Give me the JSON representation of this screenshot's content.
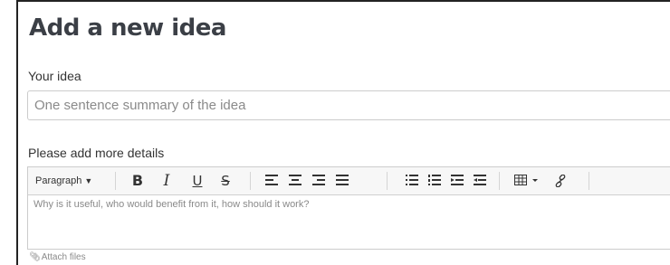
{
  "page": {
    "title": "Add a new idea"
  },
  "idea": {
    "label": "Your idea",
    "value": "",
    "placeholder": "One sentence summary of the idea"
  },
  "details": {
    "label": "Please add more details",
    "placeholder": "Why is it useful, who would benefit from it, how should it work?"
  },
  "toolbar": {
    "format_label": "Paragraph",
    "caret": "▼",
    "bold": "B",
    "italic": "I",
    "underline": "U",
    "strikethrough": "S",
    "icons": [
      "align-left-icon",
      "align-center-icon",
      "align-right-icon",
      "align-justify-icon",
      "bullet-list-icon",
      "numbered-list-icon",
      "outdent-icon",
      "indent-icon",
      "table-icon",
      "link-icon"
    ]
  },
  "attach": {
    "icon": "paperclip-icon",
    "label": "Attach files"
  },
  "colors": {
    "title": "#3b3f46",
    "border": "#cccccc",
    "placeholder": "#8a8a8a"
  }
}
